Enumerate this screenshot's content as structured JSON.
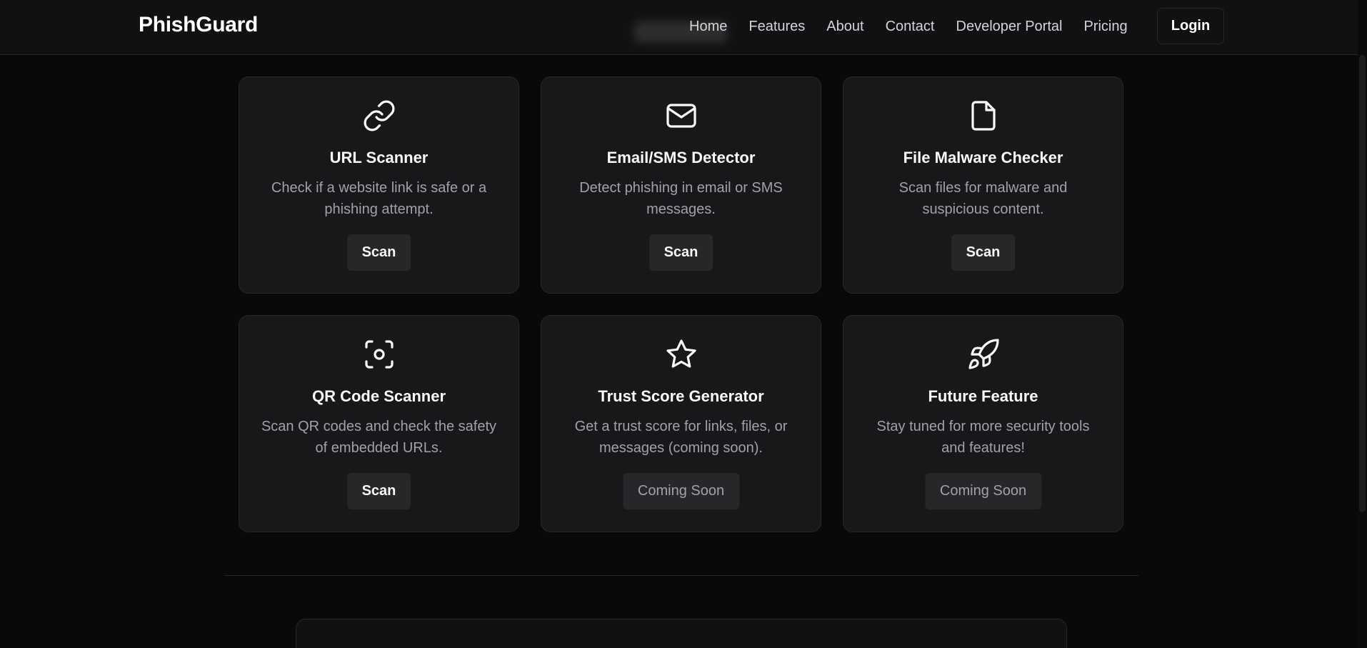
{
  "header": {
    "brand": "PhishGuard",
    "nav": [
      "Home",
      "Features",
      "About",
      "Contact",
      "Developer Portal",
      "Pricing"
    ],
    "login_label": "Login"
  },
  "cards": [
    {
      "icon": "link-icon",
      "title": "URL Scanner",
      "desc": "Check if a website link is safe or a phishing attempt.",
      "button": "Scan",
      "button_state": "active"
    },
    {
      "icon": "mail-icon",
      "title": "Email/SMS Detector",
      "desc": "Detect phishing in email or SMS messages.",
      "button": "Scan",
      "button_state": "active"
    },
    {
      "icon": "file-icon",
      "title": "File Malware Checker",
      "desc": "Scan files for malware and suspicious content.",
      "button": "Scan",
      "button_state": "active"
    },
    {
      "icon": "qr-scan-icon",
      "title": "QR Code Scanner",
      "desc": "Scan QR codes and check the safety of embedded URLs.",
      "button": "Scan",
      "button_state": "active"
    },
    {
      "icon": "star-icon",
      "title": "Trust Score Generator",
      "desc": "Get a trust score for links, files, or messages (coming soon).",
      "button": "Coming Soon",
      "button_state": "disabled"
    },
    {
      "icon": "rocket-icon",
      "title": "Future Feature",
      "desc": "Stay tuned for more security tools and features!",
      "button": "Coming Soon",
      "button_state": "disabled"
    }
  ],
  "colors": {
    "background": "#09090b",
    "card": "#18181b",
    "border": "#27272a",
    "muted_text": "#a1a1aa"
  }
}
